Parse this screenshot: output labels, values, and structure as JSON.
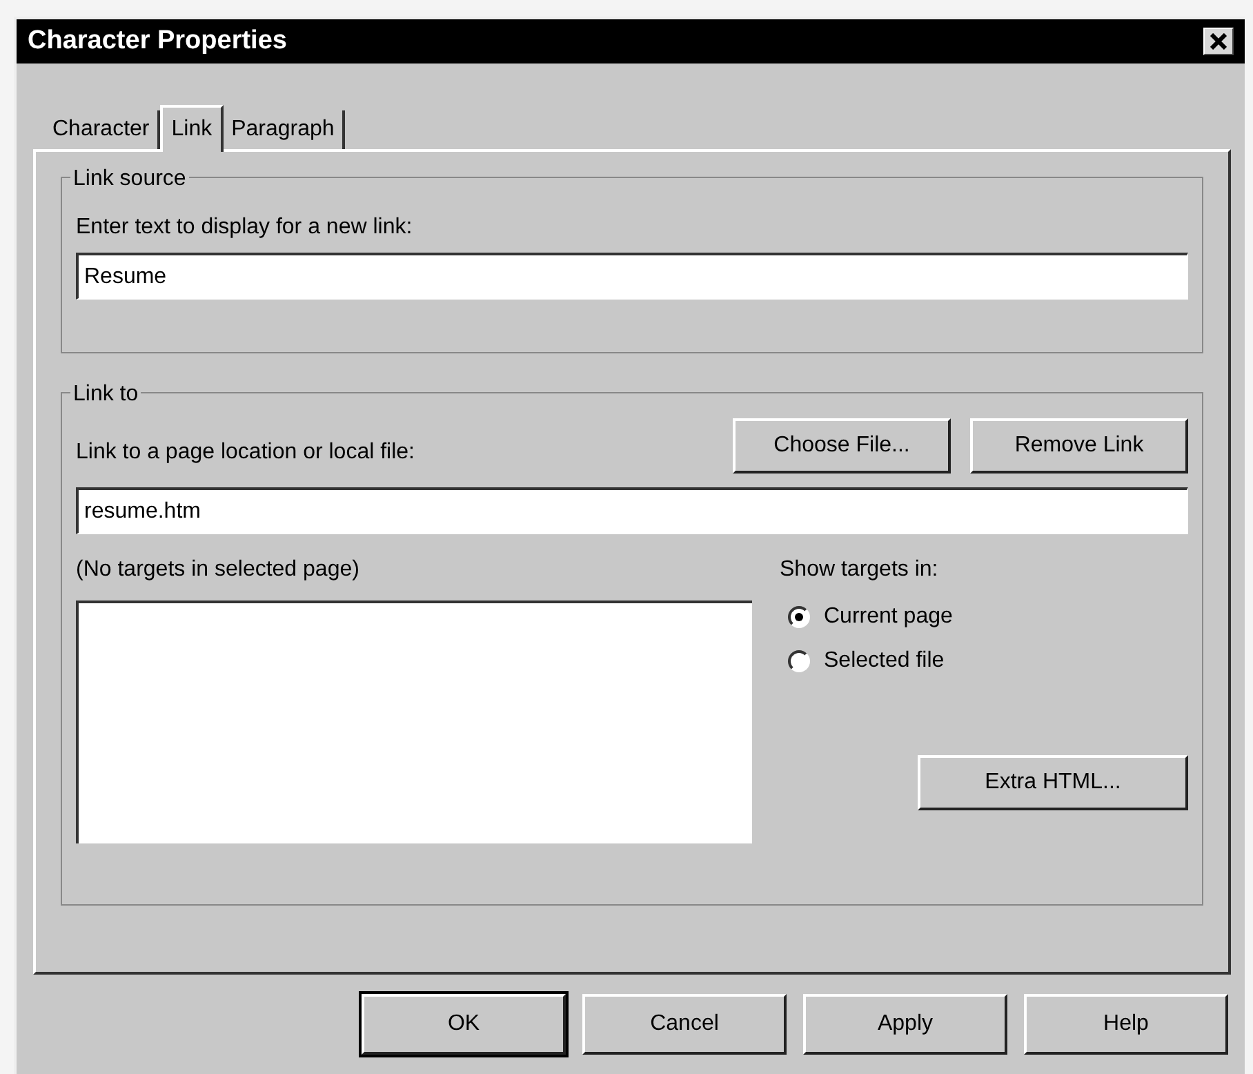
{
  "window": {
    "title": "Character Properties"
  },
  "tabs": [
    {
      "label": "Character",
      "selected": false
    },
    {
      "label": "Link",
      "selected": true
    },
    {
      "label": "Paragraph",
      "selected": false
    }
  ],
  "link_source": {
    "legend": "Link source",
    "prompt": "Enter text to display for a new link:",
    "value": "Resume"
  },
  "link_to": {
    "legend": "Link to",
    "prompt": "Link to a page location or local file:",
    "buttons": [
      "Choose File...",
      "Remove Link"
    ],
    "value": "resume.htm",
    "targets_label": "(No targets in selected page)",
    "show_targets_label": "Show targets in:",
    "options": [
      {
        "label": "Current page",
        "selected": true
      },
      {
        "label": "Selected file",
        "selected": false
      }
    ],
    "extra_button": "Extra HTML..."
  },
  "buttons": [
    {
      "label": "OK",
      "default": true
    },
    {
      "label": "Cancel",
      "default": false
    },
    {
      "label": "Apply",
      "default": false
    },
    {
      "label": "Help",
      "default": false
    }
  ]
}
